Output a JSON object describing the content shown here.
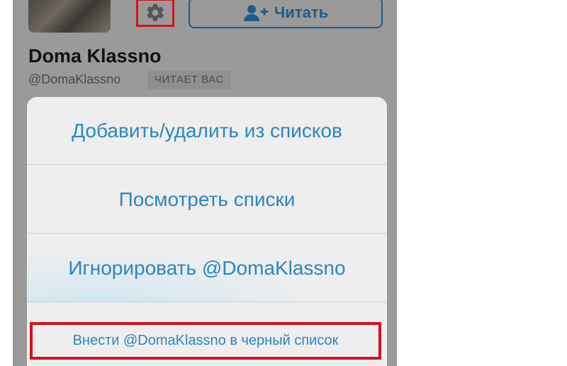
{
  "profile": {
    "name": "Doma Klassno",
    "handle": "@DomaKlassno",
    "follows_you_badge": "ЧИТАЕТ ВАС",
    "follow_button_label": "Читать"
  },
  "action_sheet": {
    "items": [
      {
        "label": "Добавить/удалить из списков"
      },
      {
        "label": "Посмотреть списки"
      },
      {
        "label": "Игнорировать @DomaKlassno"
      },
      {
        "label": "Внести @DomaKlassno в черный список"
      }
    ]
  },
  "colors": {
    "accent_blue": "#2d86bf",
    "follow_blue": "#1d5d8c",
    "highlight_red": "#d3121f",
    "dim_overlay": "#9a9a9a"
  },
  "icons": {
    "settings": "gear-icon",
    "follow": "add-user-icon"
  }
}
